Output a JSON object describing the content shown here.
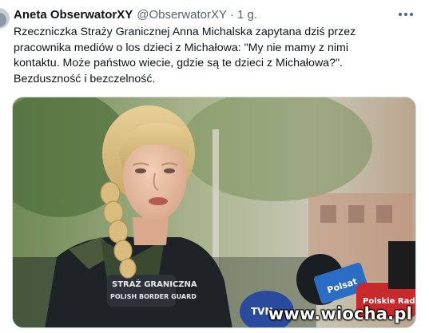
{
  "tweet": {
    "author_name": "Aneta ObserwatorXY",
    "handle": "@ObserwatorXY",
    "separator": "·",
    "time": "1 g.",
    "text_lines": [
      "Rzeczniczka Straży Granicznej Anna Michalska zapytana dziś przez",
      "pracownika mediów o los dzieci z Michałowa: \"My nie mamy z nimi",
      "kontaktu. Może państwo wiecie, gdzie są te dzieci z Michałowa?\".",
      "Bezduszność i bezczelność."
    ]
  },
  "photo": {
    "patch_lines": [
      "STRAŻ GRANICZNA",
      "POLISH BORDER GUARD"
    ],
    "mic_labels": [
      "TVN",
      "Polsat",
      "Polskie Radio"
    ],
    "watermark": "www.wiocha.pl"
  },
  "icons": {
    "avatar": "avatar-image",
    "more": "more-dots-icon"
  },
  "colors": {
    "text_primary": "#0f1419",
    "text_secondary": "#536471",
    "border": "#cfd9de"
  }
}
